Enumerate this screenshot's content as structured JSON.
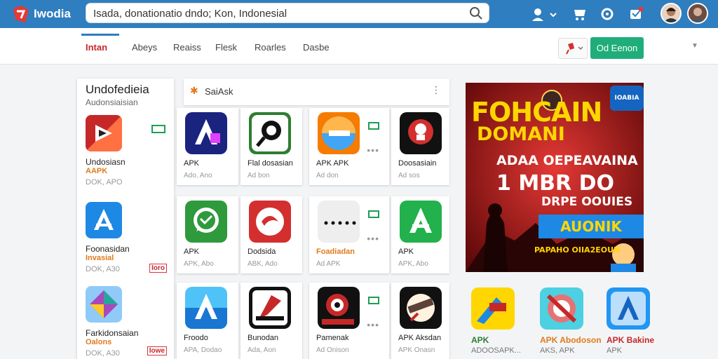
{
  "header": {
    "logo_text": "Iwodia",
    "search_value": "Isada, donationatio dndo; Kon, Indonesial"
  },
  "nav": {
    "tabs": [
      "Intan",
      "Abeys",
      "Reaiss",
      "Flesk",
      "Roarles",
      "Dasbe"
    ],
    "cta_label": "Od Eenon"
  },
  "left_panel": {
    "title": "Undofedieia",
    "subtitle": "Audonsiaisian",
    "items": [
      {
        "name": "Undosiasn",
        "tag": "AAPK",
        "meta": "DOK, APO",
        "badge": ""
      },
      {
        "name": "Foonasidan",
        "tag": "Invasial",
        "meta": "DOK, A30",
        "badge": "Ioro"
      },
      {
        "name": "Farkidonsaian",
        "tag": "Oalons",
        "meta": "DOK, A30",
        "badge": "Iowe"
      }
    ]
  },
  "grid": {
    "header": "SaiAsk",
    "rows": [
      [
        {
          "name": "APK",
          "meta": "Ado, Ano"
        },
        {
          "name": "Flal dosasian",
          "meta": "Ad bon"
        },
        {
          "name": "APK APK",
          "meta": "Ad don"
        },
        {
          "name": "Doosasiain",
          "meta": "Ad sos"
        }
      ],
      [
        {
          "name": "APK",
          "meta": "APK, Abo"
        },
        {
          "name": "Dodsida",
          "meta": "ABK, Ado"
        },
        {
          "name": "Foadiadan",
          "meta": "Ad APK"
        },
        {
          "name": "APK",
          "meta": "APK, Abo"
        }
      ],
      [
        {
          "name": "Froodo",
          "meta": "APA, Dodao"
        },
        {
          "name": "Bunodan",
          "meta": "Ada, Aon"
        },
        {
          "name": "Pamenak",
          "meta": "Ad Onison"
        },
        {
          "name": "APK Aksdan",
          "meta": "APK Onasn"
        }
      ]
    ]
  },
  "banner": {
    "line1": "FOHCAIN",
    "line2": "DOMANI",
    "line3": "ADAA OEPEAVAINA",
    "line4": "1 MBR DO",
    "line5": "DRPE OOUIES",
    "line6": "AUONIK",
    "line7": "PAPAHO OIIA2EOUN",
    "badge": "IOABIA"
  },
  "bottom_apps": [
    {
      "name": "APK",
      "meta": "ADOOSAPK..."
    },
    {
      "name": "APK Abodoson",
      "meta": "AKS, APK"
    },
    {
      "name": "APK Bakine",
      "meta": "APK"
    }
  ],
  "colors": {
    "topbar": "#2f7ebf",
    "accent_green": "#1fae7a",
    "accent_red": "#c62828",
    "accent_orange": "#e07b1b"
  }
}
